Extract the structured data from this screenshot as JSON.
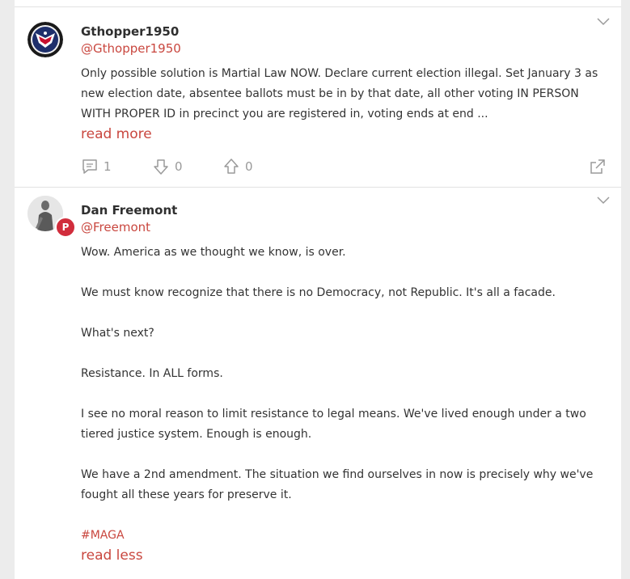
{
  "posts": [
    {
      "name": "Gthopper1950",
      "handle": "@Gthopper1950",
      "text": "Only possible solution is Martial Law NOW. Declare current election illegal. Set January 3 as new election date, absentee ballots must be in by that date, all other voting IN PERSON WITH PROPER ID in precinct you are registered in, voting ends at end ...",
      "toggle_label": "read more",
      "comments": "1",
      "downvotes": "0",
      "upvotes": "0",
      "avatar_icon": "eagle-flag-icon"
    },
    {
      "name": "Dan Freemont",
      "handle": "@Freemont",
      "badge_letter": "P",
      "paragraphs": [
        "Wow. America as we thought we know, is over.",
        "We must know recognize that there is no Democracy, not Republic. It's all a facade.",
        "What's next?",
        "Resistance. In ALL forms.",
        "I see no moral reason to limit resistance to legal means. We've lived enough under a two tiered justice system. Enough is enough.",
        "We have a 2nd amendment. The situation we find ourselves in now is precisely why we've fought all these years for preserve it."
      ],
      "hashtag": "#MAGA",
      "toggle_label": "read less",
      "avatar_icon": "statue-icon"
    }
  ],
  "colors": {
    "accent": "#c9473f",
    "badge": "#d12d3c",
    "muted": "#9a9a9a"
  }
}
